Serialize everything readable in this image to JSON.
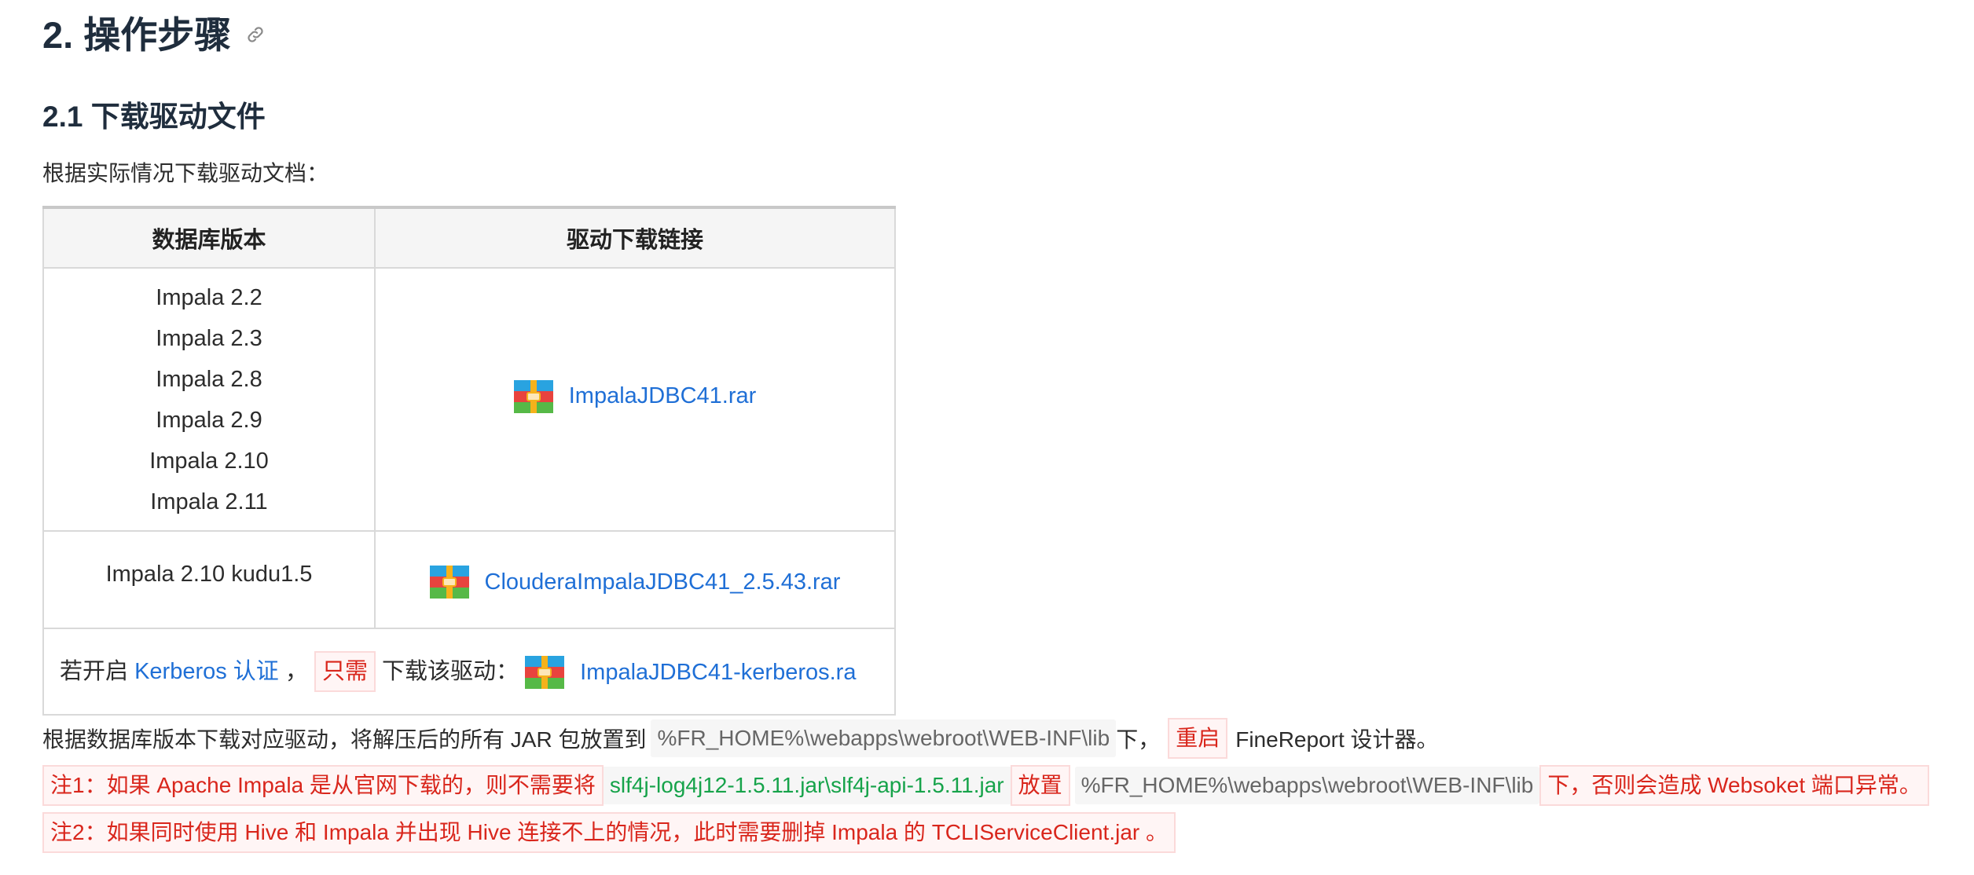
{
  "heading": {
    "title": "2. 操作步骤",
    "icon": "link-icon"
  },
  "subheading": {
    "title": "2.1 下载驱动文件"
  },
  "intro": "根据实际情况下载驱动文档：",
  "table": {
    "headers": [
      "数据库版本",
      "驱动下载链接"
    ],
    "row1": {
      "versions": [
        "Impala 2.2",
        "Impala 2.3",
        "Impala 2.8",
        "Impala 2.9",
        "Impala 2.10",
        "Impala 2.11"
      ],
      "file": "ImpalaJDBC41.rar"
    },
    "row2": {
      "version": "Impala 2.10 kudu1.5",
      "file": "ClouderaImpalaJDBC41_2.5.43.rar"
    },
    "row3": {
      "prefix": "若开启",
      "link": "Kerberos 认证",
      "comma": "，",
      "tag": "只需",
      "middle": "下载该驱动：",
      "file": "ImpalaJDBC41-kerberos.ra"
    }
  },
  "para1": {
    "text1": "根据数据库版本下载对应驱动，将解压后的所有 JAR 包放置到",
    "path": "%FR_HOME%\\webapps\\webroot\\WEB-INF\\lib",
    "text2": "下，",
    "tag": "重启",
    "text3": "FineReport 设计器。"
  },
  "note1": {
    "text1": "注1：如果 Apache Impala 是从官网下载的，则不需要将",
    "jars": "slf4j-log4j12-1.5.11.jar\\slf4j-api-1.5.11.jar",
    "text2": "放置",
    "path": "%FR_HOME%\\webapps\\webroot\\WEB-INF\\lib",
    "text3": "下，否则会造成 Websoket 端口异常。"
  },
  "note2": {
    "text": "注2：如果同时使用 Hive 和 Impala 并出现 Hive 连接不上的情况，此时需要删掉 Impala 的 TCLIServiceClient.jar 。"
  },
  "colors": {
    "link": "#1f6fd6",
    "warning": "#d9261c",
    "code_green": "#16a34a"
  }
}
